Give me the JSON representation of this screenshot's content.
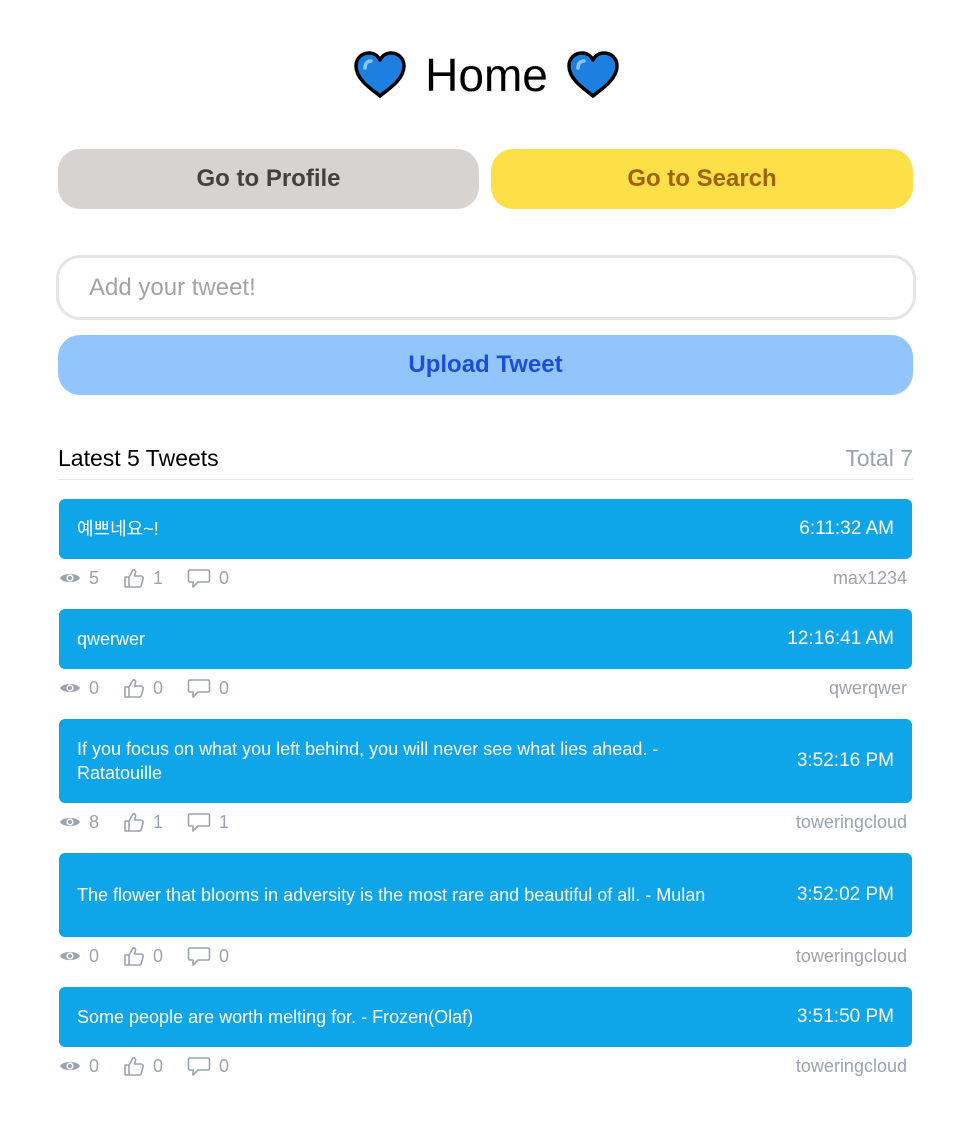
{
  "header": {
    "title": "Home",
    "left_icon": "blue-heart-icon",
    "right_icon": "blue-heart-icon"
  },
  "nav": {
    "profile_label": "Go to Profile",
    "search_label": "Go to Search"
  },
  "composer": {
    "placeholder": "Add your tweet!",
    "upload_label": "Upload Tweet"
  },
  "list": {
    "title": "Latest 5 Tweets",
    "total": "Total 7"
  },
  "tweets": [
    {
      "text": "예쁘네요~!",
      "time": "6:11:32 AM",
      "views": "5",
      "likes": "1",
      "comments": "0",
      "author": "max1234"
    },
    {
      "text": "qwerwer",
      "time": "12:16:41 AM",
      "views": "0",
      "likes": "0",
      "comments": "0",
      "author": "qwerqwer"
    },
    {
      "text": "If you focus on what you left behind, you will never see what lies ahead. - Ratatouille",
      "time": "3:52:16 PM",
      "views": "8",
      "likes": "1",
      "comments": "1",
      "author": "toweringcloud"
    },
    {
      "text": "The flower that blooms in adversity is the most rare and beautiful of all. - Mulan",
      "time": "3:52:02 PM",
      "views": "0",
      "likes": "0",
      "comments": "0",
      "author": "toweringcloud"
    },
    {
      "text": "Some people are worth melting for. - Frozen(Olaf)",
      "time": "3:51:50 PM",
      "views": "0",
      "likes": "0",
      "comments": "0",
      "author": "toweringcloud"
    }
  ],
  "colors": {
    "tweet_bg": "#0ea5e9",
    "profile_bg": "#d6d3d1",
    "search_bg": "#fde047",
    "upload_bg": "#93c5fd",
    "heart": "#1d7fe0"
  }
}
